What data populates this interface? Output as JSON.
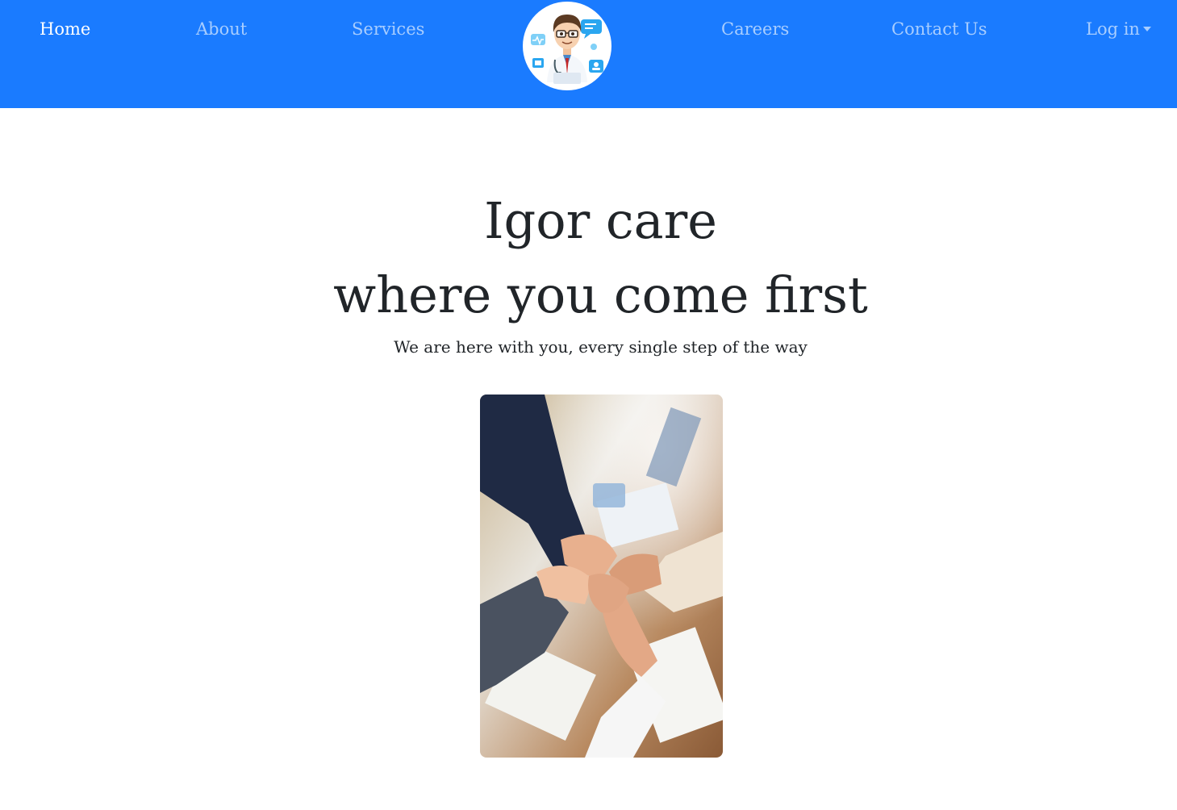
{
  "nav": {
    "items": [
      {
        "label": "Home",
        "active": true
      },
      {
        "label": "About",
        "active": false
      },
      {
        "label": "Services",
        "active": false
      },
      {
        "label": "Careers",
        "active": false
      },
      {
        "label": "Contact Us",
        "active": false
      }
    ],
    "login_label": "Log in",
    "logo_icon": "doctor-avatar-icon"
  },
  "hero": {
    "title_line1": "Igor care",
    "title_line2": "where you come first",
    "subtitle": "We are here with you, every single step of the way",
    "image_icon": "team-hands-photo"
  },
  "colors": {
    "navbar": "#1a7bff",
    "text": "#212529",
    "nav_active": "#ffffff",
    "nav_inactive": "#a9ccff"
  }
}
